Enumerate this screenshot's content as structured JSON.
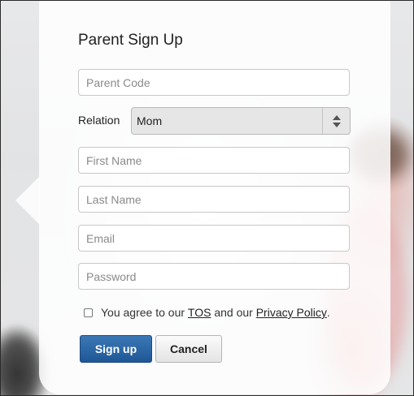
{
  "form": {
    "title": "Parent Sign Up",
    "parent_code_placeholder": "Parent Code",
    "relation_label": "Relation",
    "relation_value": "Mom",
    "first_name_placeholder": "First Name",
    "last_name_placeholder": "Last Name",
    "email_placeholder": "Email",
    "password_placeholder": "Password",
    "agree_prefix": "You agree to our ",
    "tos_link": "TOS",
    "agree_middle": " and our ",
    "privacy_link": "Privacy Policy",
    "agree_suffix": ".",
    "signup_label": "Sign up",
    "cancel_label": "Cancel"
  },
  "icons": {
    "select_arrows": "up-down-chevron-icon"
  },
  "colors": {
    "primary_button": "#2a66a6",
    "card_background": "#ffffff"
  }
}
